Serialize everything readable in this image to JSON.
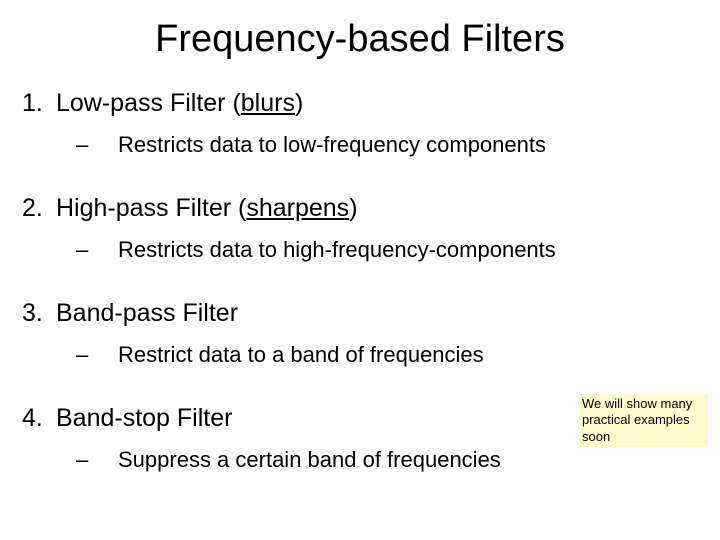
{
  "title": "Frequency-based Filters",
  "items": [
    {
      "num": "1.",
      "heading_prefix": "Low-pass Filter (",
      "heading_underlined": "blurs",
      "heading_suffix": ")",
      "sub": "Restricts data to low-frequency components"
    },
    {
      "num": "2.",
      "heading_prefix": "High-pass Filter (",
      "heading_underlined": "sharpens",
      "heading_suffix": ")",
      "sub": "Restricts data to high-frequency-components"
    },
    {
      "num": "3.",
      "heading_prefix": "Band-pass Filter",
      "heading_underlined": "",
      "heading_suffix": "",
      "sub": "Restrict data to a band of frequencies"
    },
    {
      "num": "4.",
      "heading_prefix": "Band-stop Filter",
      "heading_underlined": "",
      "heading_suffix": "",
      "sub": "Suppress a certain band of frequencies"
    }
  ],
  "dash": "–",
  "note": "We will show many practical examples soon"
}
